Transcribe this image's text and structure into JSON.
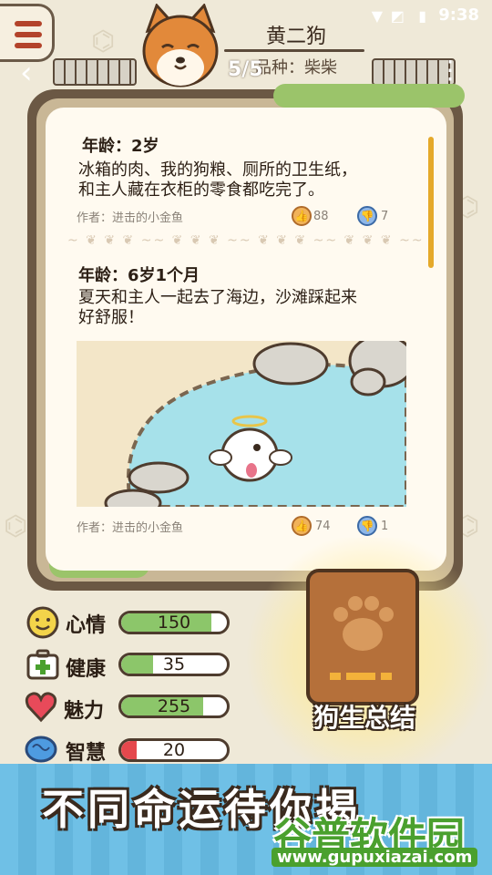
{
  "status_bar": {
    "time": "9:38"
  },
  "header": {
    "dog_name": "黄二狗",
    "breed": "品种：柴柴",
    "page_counter": "5/5",
    "back_icon": "chevron-left-icon",
    "more_icon": "more-icon"
  },
  "diary": {
    "entries": [
      {
        "age": "年龄：2岁",
        "text_lines": [
          "冰箱的肉、我的狗粮、厕所的卫生纸，",
          "和主人藏在衣柜的零食都吃完了。"
        ],
        "author": "作者：进击的小金鱼",
        "likes": "88",
        "dislikes": "7"
      },
      {
        "age": "年龄：6岁1个月",
        "text_lines": [
          "夏天和主人一起去了海边，沙滩踩起来",
          "好舒服！"
        ],
        "author": "作者：进击的小金鱼",
        "likes": "74",
        "dislikes": "1"
      }
    ]
  },
  "stats": [
    {
      "label": "心情",
      "value": "150",
      "fill": 0.85,
      "color": "#8cc66a",
      "icon": "smiley-icon"
    },
    {
      "label": "健康",
      "value": "35",
      "fill": 0.3,
      "color": "#8cc66a",
      "icon": "first-aid-kit-icon"
    },
    {
      "label": "魅力",
      "value": "255",
      "fill": 0.78,
      "color": "#8cc66a",
      "icon": "heart-icon"
    },
    {
      "label": "智慧",
      "value": "20",
      "fill": 0.15,
      "color": "#e5484d",
      "icon": "brain-icon"
    }
  ],
  "summary": {
    "label": "狗生总结",
    "icon": "paw-book-icon"
  },
  "banner": {
    "text": "不同命运待你揭"
  },
  "watermark": {
    "title": "谷普软件园",
    "url": "www.gupuxiazai.com"
  },
  "colors": {
    "background": "#efe9d8",
    "frame": "#6b5844",
    "paper": "#fffaf0",
    "banner": "#6fc0e6",
    "accent": "#e5a92a"
  }
}
